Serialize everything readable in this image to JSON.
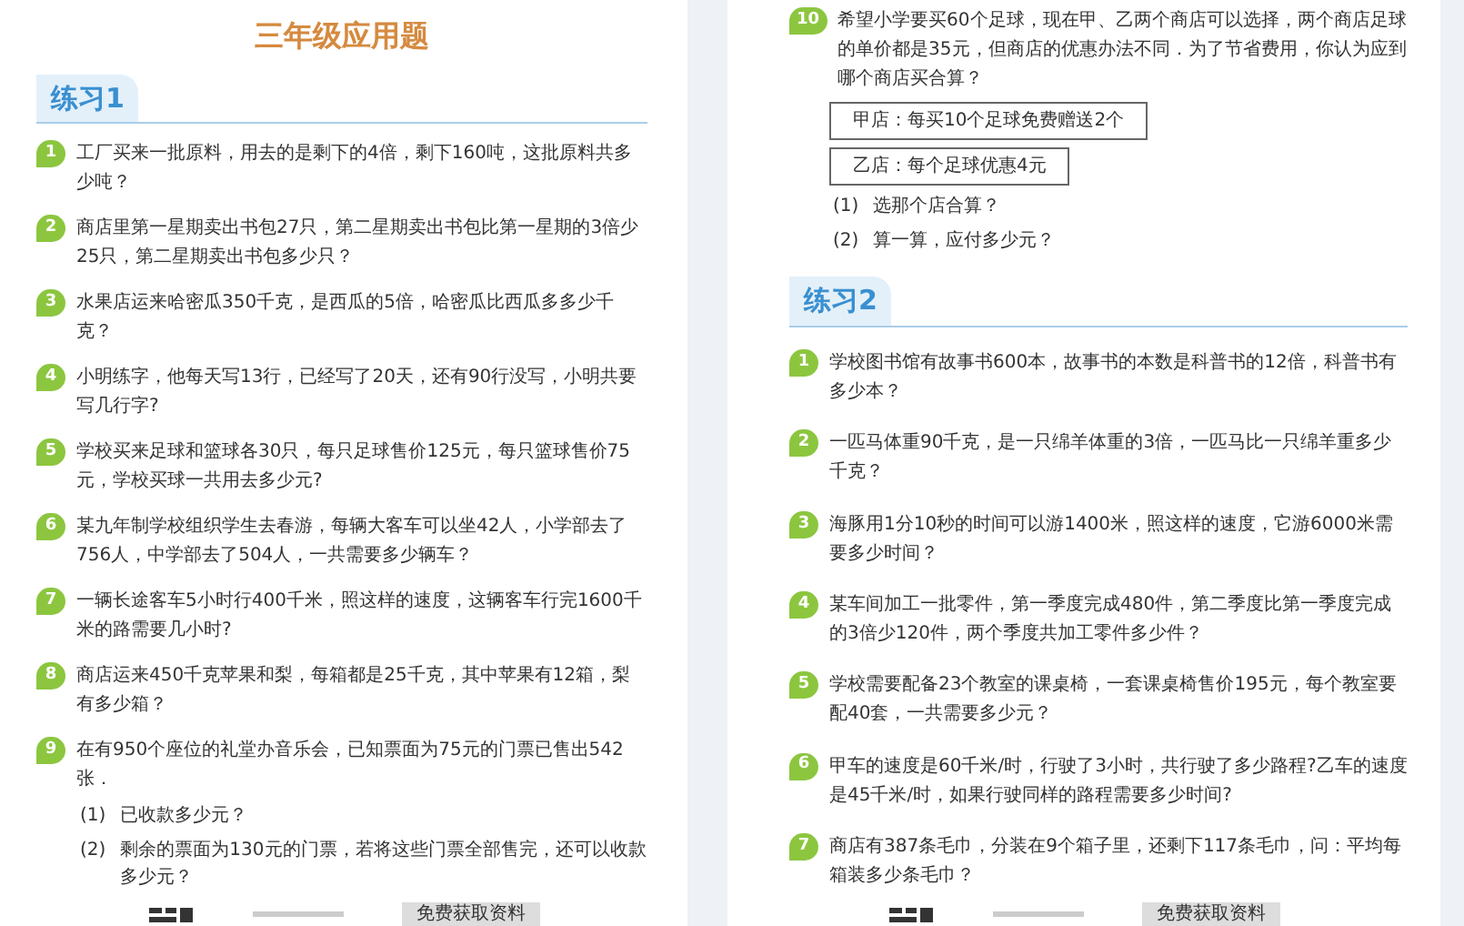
{
  "pages": [
    {
      "title": "三年级应用题",
      "items": [
        {
          "kind": "heading",
          "text": "练习1"
        },
        {
          "kind": "question",
          "number": "1",
          "text": "工厂买来一批原料，用去的是剩下的4倍，剩下160吨，这批原料共多少吨？"
        },
        {
          "kind": "question",
          "number": "2",
          "text": "商店里第一星期卖出书包27只，第二星期卖出书包比第一星期的3倍少25只，第二星期卖出书包多少只？"
        },
        {
          "kind": "question",
          "number": "3",
          "text": "水果店运来哈密瓜350千克，是西瓜的5倍，哈密瓜比西瓜多多少千克？"
        },
        {
          "kind": "question",
          "number": "4",
          "text": "小明练字，他每天写13行，已经写了20天，还有90行没写，小明共要写几行字?"
        },
        {
          "kind": "question",
          "number": "5",
          "text": "学校买来足球和篮球各30只，每只足球售价125元，每只篮球售价75元，学校买球一共用去多少元?"
        },
        {
          "kind": "question",
          "number": "6",
          "text": "某九年制学校组织学生去春游，每辆大客车可以坐42人，小学部去了756人，中学部去了504人，一共需要多少辆车？"
        },
        {
          "kind": "question",
          "number": "7",
          "text": "一辆长途客车5小时行400千米，照这样的速度，这辆客车行完1600千米的路需要几小时?"
        },
        {
          "kind": "question",
          "number": "8",
          "text": "商店运来450千克苹果和梨，每箱都是25千克，其中苹果有12箱，梨有多少箱？"
        },
        {
          "kind": "question",
          "number": "9",
          "text": "在有950个座位的礼堂办音乐会，已知票面为75元的门票已售出542张．",
          "parts": [
            {
              "number": "(1)",
              "text": "已收款多少元？"
            },
            {
              "number": "(2)",
              "text": "剩余的票面为130元的门票，若将这些门票全部售完，还可以收款多少元？"
            }
          ]
        }
      ],
      "footer": {
        "button": "免费获取资料"
      }
    },
    {
      "items": [
        {
          "kind": "question",
          "number": "10",
          "text": "希望小学要买60个足球，现在甲、乙两个商店可以选择，两个商店足球的单价都是35元，但商店的优惠办法不同．为了节省费用，你认为应到哪个商店买合算？",
          "offers": [
            "甲店：每买10个足球免费赠送2个",
            "乙店：每个足球优惠4元"
          ],
          "parts": [
            {
              "number": "(1)",
              "text": "选那个店合算？"
            },
            {
              "number": "(2)",
              "text": "算一算，应付多少元？"
            }
          ]
        },
        {
          "kind": "heading",
          "text": "练习2"
        },
        {
          "kind": "question",
          "number": "1",
          "text": "学校图书馆有故事书600本，故事书的本数是科普书的12倍，科普书有多少本？"
        },
        {
          "kind": "question",
          "number": "2",
          "text": "一匹马体重90千克，是一只绵羊体重的3倍，一匹马比一只绵羊重多少千克？"
        },
        {
          "kind": "question",
          "number": "3",
          "text": "海豚用1分10秒的时间可以游1400米，照这样的速度，它游6000米需要多少时间？"
        },
        {
          "kind": "question",
          "number": "4",
          "text": "某车间加工一批零件，第一季度完成480件，第二季度比第一季度完成的3倍少120件，两个季度共加工零件多少件？"
        },
        {
          "kind": "question",
          "number": "5",
          "text": "学校需要配备23个教室的课桌椅，一套课桌椅售价195元，每个教室要配40套，一共需要多少元？"
        },
        {
          "kind": "question",
          "number": "6",
          "text": "甲车的速度是60千米/时，行驶了3小时，共行驶了多少路程?乙车的速度是45千米/时，如果行驶同样的路程需要多少时间?"
        },
        {
          "kind": "question",
          "number": "7",
          "text": "商店有387条毛巾，分装在9个箱子里，还剩下117条毛巾，问：平均每箱装多少条毛巾？"
        }
      ],
      "footer": {
        "button": "免费获取资料"
      }
    }
  ]
}
